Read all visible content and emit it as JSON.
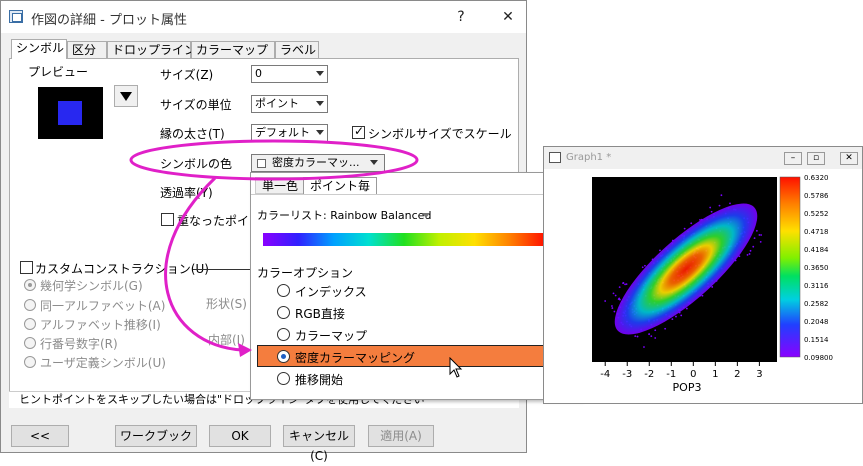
{
  "dialog": {
    "title": "作図の詳細 - プロット属性",
    "help": "?",
    "close": "✕",
    "tabs": [
      "シンボル",
      "区分",
      "ドロップライン",
      "カラーマップ",
      "ラベル"
    ],
    "preview_label": "プレビュー",
    "size_label": "サイズ(Z)",
    "size_value": "0",
    "size_unit_label": "サイズの単位",
    "size_unit_value": "ポイント",
    "edge_width_label": "縁の太さ(T)",
    "edge_width_value": "デフォルト",
    "scale_checkbox_label": "シンボルサイズでスケール",
    "symbol_color_label": "シンボルの色",
    "symbol_color_value": "密度カラーマッ...",
    "transparency_label": "透過率(Y)",
    "overlap_label": "重なったポイン",
    "custom_construction_label": "カスタムコンストラクション(U)",
    "radio_options": [
      "幾何学シンボル(G)",
      "同一アルファベット(A)",
      "アルファベット推移(I)",
      "行番号数字(R)",
      "ユーザ定義シンボル(U)"
    ],
    "shape_label": "形状(S)",
    "interior_label": "内部(I)",
    "hint_text": "ヒントポイントをスキップしたい場合は\"ドロップライン\"タブを使用してください",
    "buttons": {
      "collapse": "<<",
      "workbook": "ワークブック",
      "ok": "OK",
      "cancel": "キャンセル(C)",
      "apply": "適用(A)"
    }
  },
  "popup": {
    "tab_single": "単一色",
    "tab_per_point": "ポイント毎",
    "colorlist_label": "カラーリスト: Rainbow Balanced",
    "color_options_label": "カラーオプション",
    "options": [
      "インデックス",
      "RGB直接",
      "カラーマップ",
      "密度カラーマッピング",
      "推移開始"
    ],
    "selected_option": "密度カラーマッピング"
  },
  "graph": {
    "title": "Graph1 *",
    "xlabel": "POP3",
    "colorbar_ticks": [
      "0.6320",
      "0.5786",
      "0.5252",
      "0.4718",
      "0.4184",
      "0.3650",
      "0.3116",
      "0.2582",
      "0.2048",
      "0.1514",
      "0.09800"
    ]
  },
  "chart_data": {
    "type": "scatter",
    "title": "",
    "xlabel": "POP3",
    "ylabel": "",
    "xticks": [
      "-4",
      "-3",
      "-2",
      "-1",
      "0",
      "1",
      "2",
      "3"
    ],
    "xlim": [
      -4.6,
      3.8
    ],
    "colorbar_range": [
      0.098,
      0.632
    ],
    "colormap": "Rainbow Balanced",
    "description_values": {
      "center": [
        0,
        0
      ]
    }
  },
  "colors": {
    "highlight_orange": "#f47d3e",
    "annotation_magenta": "#e020c8",
    "symbol_blue": "#2828f0"
  }
}
